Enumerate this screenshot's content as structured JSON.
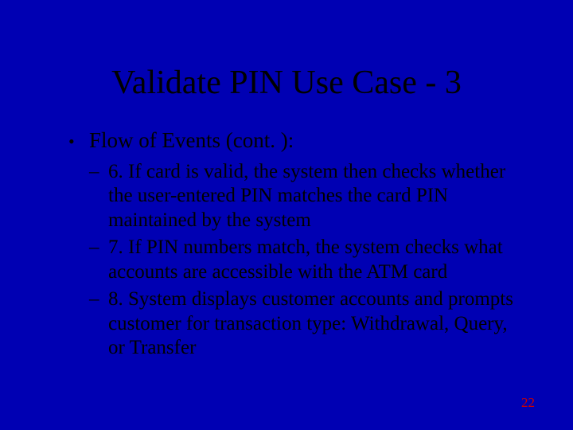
{
  "title": "Validate PIN Use Case - 3",
  "body": {
    "level1": {
      "bullet": "•",
      "text": "Flow of Events (cont. ):"
    },
    "items": [
      {
        "dash": "–",
        "text": "6. If card is valid, the system then checks whether the user-entered PIN matches the card PIN maintained by the system"
      },
      {
        "dash": "–",
        "text": "7. If PIN numbers match, the system checks what accounts are accessible with the ATM card"
      },
      {
        "dash": "–",
        "text": "8. System displays customer accounts and prompts customer for transaction type: Withdrawal, Query, or Transfer"
      }
    ]
  },
  "page_number": "22"
}
